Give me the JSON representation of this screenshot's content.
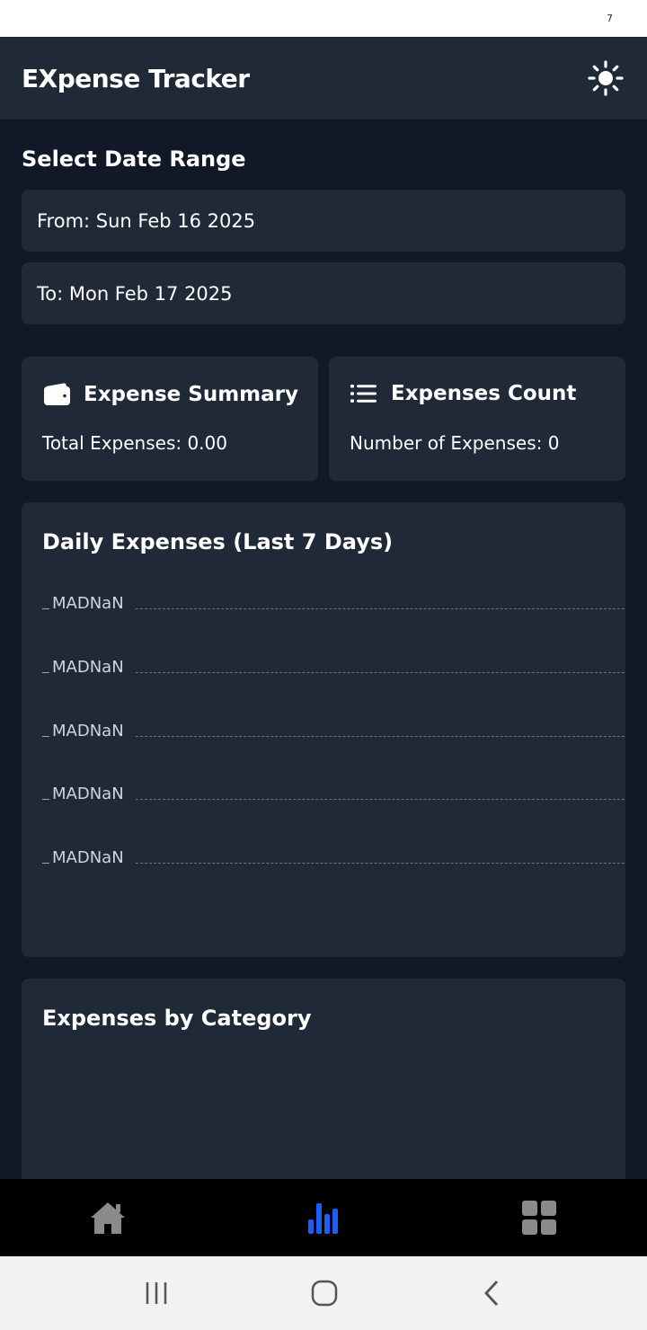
{
  "status_bar": {
    "mark": "7"
  },
  "header": {
    "title": "EXpense Tracker",
    "theme_icon": "sun-icon"
  },
  "date_range": {
    "title": "Select Date Range",
    "from": "From: Sun Feb 16 2025",
    "to": "To: Mon Feb 17 2025"
  },
  "summary_card": {
    "icon": "wallet-icon",
    "title": "Expense Summary",
    "text": "Total Expenses: 0.00"
  },
  "count_card": {
    "icon": "list-icon",
    "title": "Expenses Count",
    "text": "Number of Expenses: 0"
  },
  "daily_chart": {
    "title": "Daily Expenses (Last 7 Days)",
    "tick_labels": [
      "MADNaN",
      "MADNaN",
      "MADNaN",
      "MADNaN",
      "MADNaN"
    ]
  },
  "category_chart": {
    "title": "Expenses by Category"
  },
  "bottom_nav": {
    "items": [
      {
        "icon": "home-icon",
        "active": false
      },
      {
        "icon": "bar-chart-icon",
        "active": true
      },
      {
        "icon": "grid-icon",
        "active": false
      }
    ],
    "active_color": "#1d5ff5",
    "inactive_color": "#8a8a8a"
  },
  "system_nav": {
    "recents_icon": "recents-icon",
    "home_icon": "circle-home-icon",
    "back_icon": "back-icon"
  },
  "chart_data": {
    "type": "line",
    "title": "Daily Expenses (Last 7 Days)",
    "y_tick_labels": [
      "MADNaN",
      "MADNaN",
      "MADNaN",
      "MADNaN",
      "MADNaN"
    ],
    "series": [],
    "grid": true
  }
}
